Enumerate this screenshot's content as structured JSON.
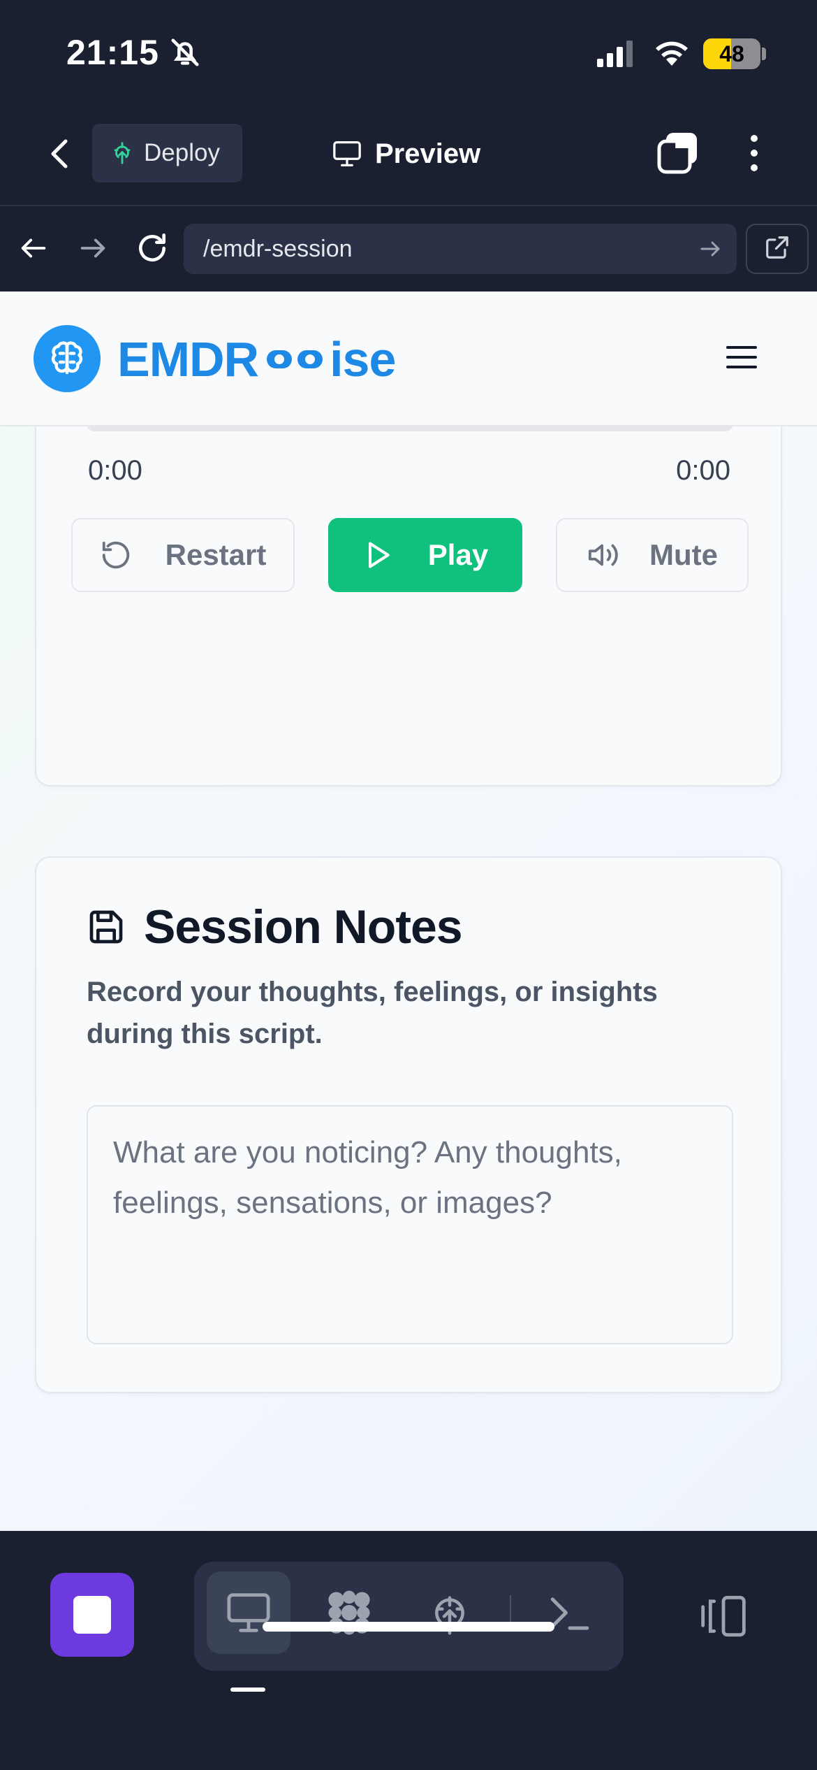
{
  "status_bar": {
    "time": "21:15",
    "battery": "48",
    "battery_color": "#ffd60a"
  },
  "toolbar": {
    "deploy_label": "Deploy",
    "preview_label": "Preview",
    "icons": [
      "chevron-left-icon",
      "deploy-icon",
      "monitor-icon",
      "tabs-icon",
      "more-vertical-icon"
    ]
  },
  "urlbar": {
    "url": "/emdr-session"
  },
  "site": {
    "logo_left": "EMDR",
    "logo_right": "ise",
    "brand_color": "#2196f3"
  },
  "player": {
    "current_time": "0:00",
    "duration": "0:00",
    "progress": 0,
    "restart_label": "Restart",
    "play_label": "Play",
    "mute_label": "Mute",
    "play_color": "#10c17d"
  },
  "notes": {
    "title": "Session Notes",
    "subtitle": "Record your thoughts, feelings, or insights during this script.",
    "placeholder": "What are you noticing? Any thoughts, feelings, sensations, or images?"
  },
  "dock": {
    "stop_color": "#6d3ae0",
    "icons": [
      "stop-icon",
      "preview-monitor-icon",
      "integrations-icon",
      "deploy-tree-icon",
      "terminal-icon",
      "layout-toggle-icon"
    ]
  }
}
